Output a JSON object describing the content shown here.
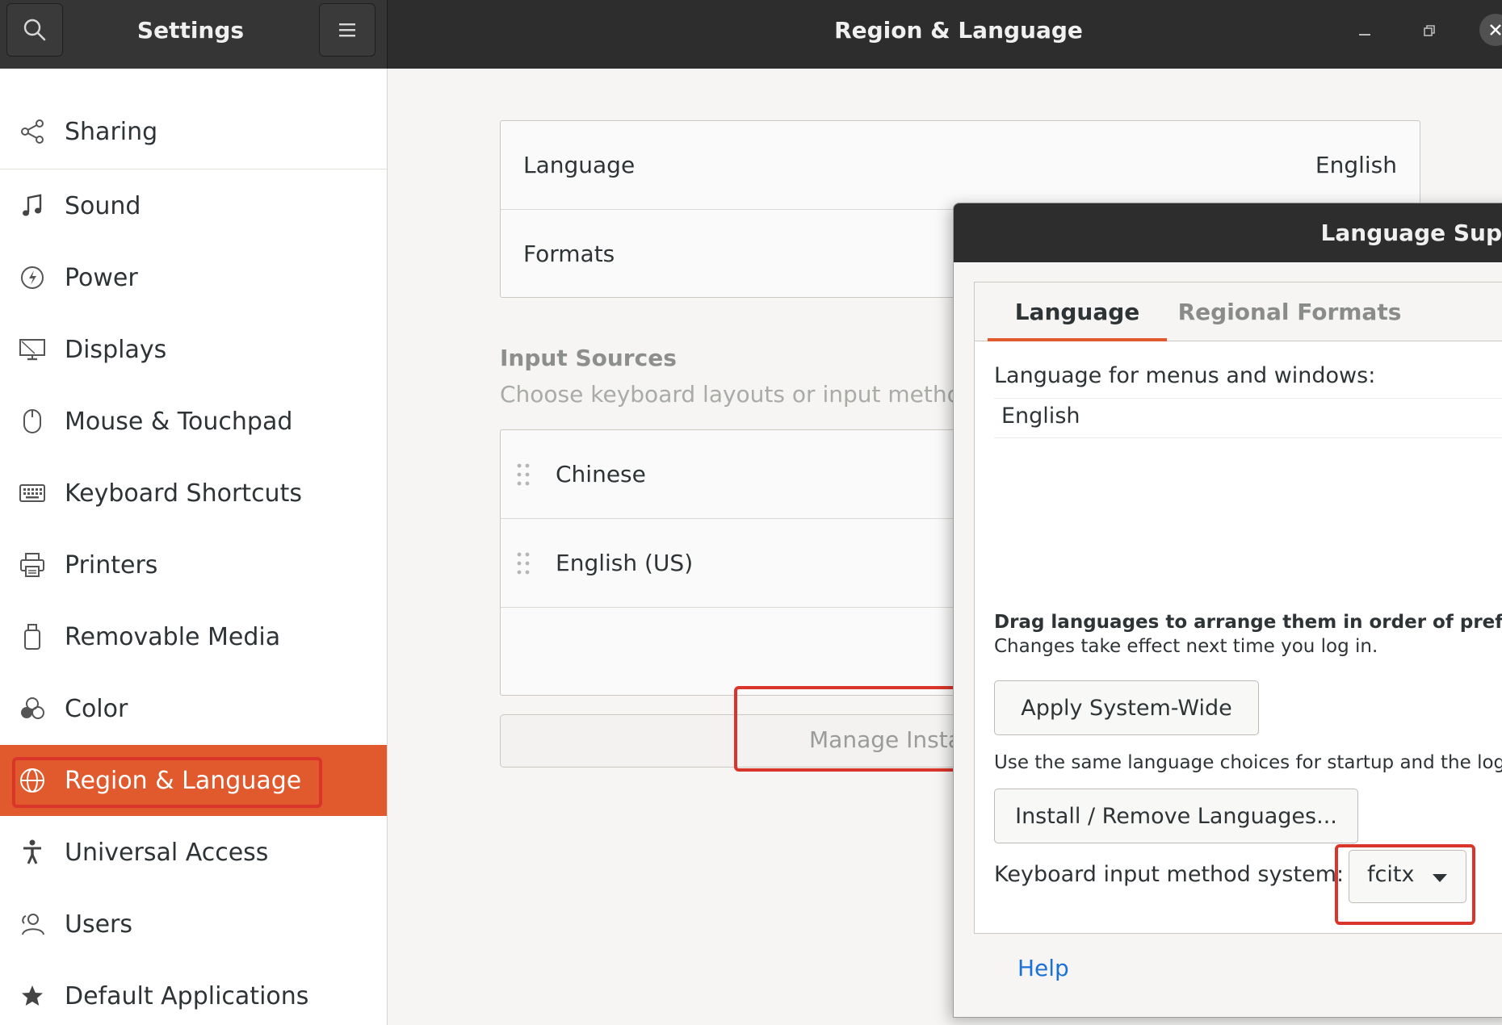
{
  "header": {
    "app_title": "Settings",
    "window_title": "Region & Language",
    "search_icon": "search-icon",
    "menu_icon": "hamburger-menu-icon"
  },
  "sidebar": {
    "items": [
      {
        "label": "Sharing",
        "icon": "share-icon"
      },
      {
        "label": "Sound",
        "icon": "music-note-icon"
      },
      {
        "label": "Power",
        "icon": "power-icon"
      },
      {
        "label": "Displays",
        "icon": "display-icon"
      },
      {
        "label": "Mouse & Touchpad",
        "icon": "mouse-icon"
      },
      {
        "label": "Keyboard Shortcuts",
        "icon": "keyboard-icon"
      },
      {
        "label": "Printers",
        "icon": "printer-icon"
      },
      {
        "label": "Removable Media",
        "icon": "usb-drive-icon"
      },
      {
        "label": "Color",
        "icon": "color-icon"
      },
      {
        "label": "Region & Language",
        "icon": "globe-icon",
        "selected": true
      },
      {
        "label": "Universal Access",
        "icon": "accessibility-icon"
      },
      {
        "label": "Users",
        "icon": "users-icon"
      },
      {
        "label": "Default Applications",
        "icon": "star-icon"
      }
    ]
  },
  "main": {
    "language_label": "Language",
    "language_value": "English",
    "formats_label": "Formats",
    "input_sources_title": "Input Sources",
    "input_sources_subtitle": "Choose keyboard layouts or input methods",
    "input_sources": [
      "Chinese",
      "English (US)"
    ],
    "manage_button": "Manage Insta"
  },
  "dialog": {
    "title": "Language Support",
    "tabs": [
      "Language",
      "Regional Formats"
    ],
    "menus_label": "Language for menus and windows:",
    "languages": [
      "English"
    ],
    "drag_hint": "Drag languages to arrange them in order of preference",
    "effect_note": "Changes take effect next time you log in.",
    "apply_button": "Apply System-Wide",
    "apply_note": "Use the same language choices for startup and the login s",
    "install_button": "Install / Remove Languages...",
    "im_label": "Keyboard input method system:",
    "im_value": "fcitx",
    "help_link": "Help"
  },
  "colors": {
    "accent": "#e05a2e",
    "highlight_box": "#d9352a",
    "headerbar": "#2d2d2d",
    "link": "#1c71d8"
  }
}
